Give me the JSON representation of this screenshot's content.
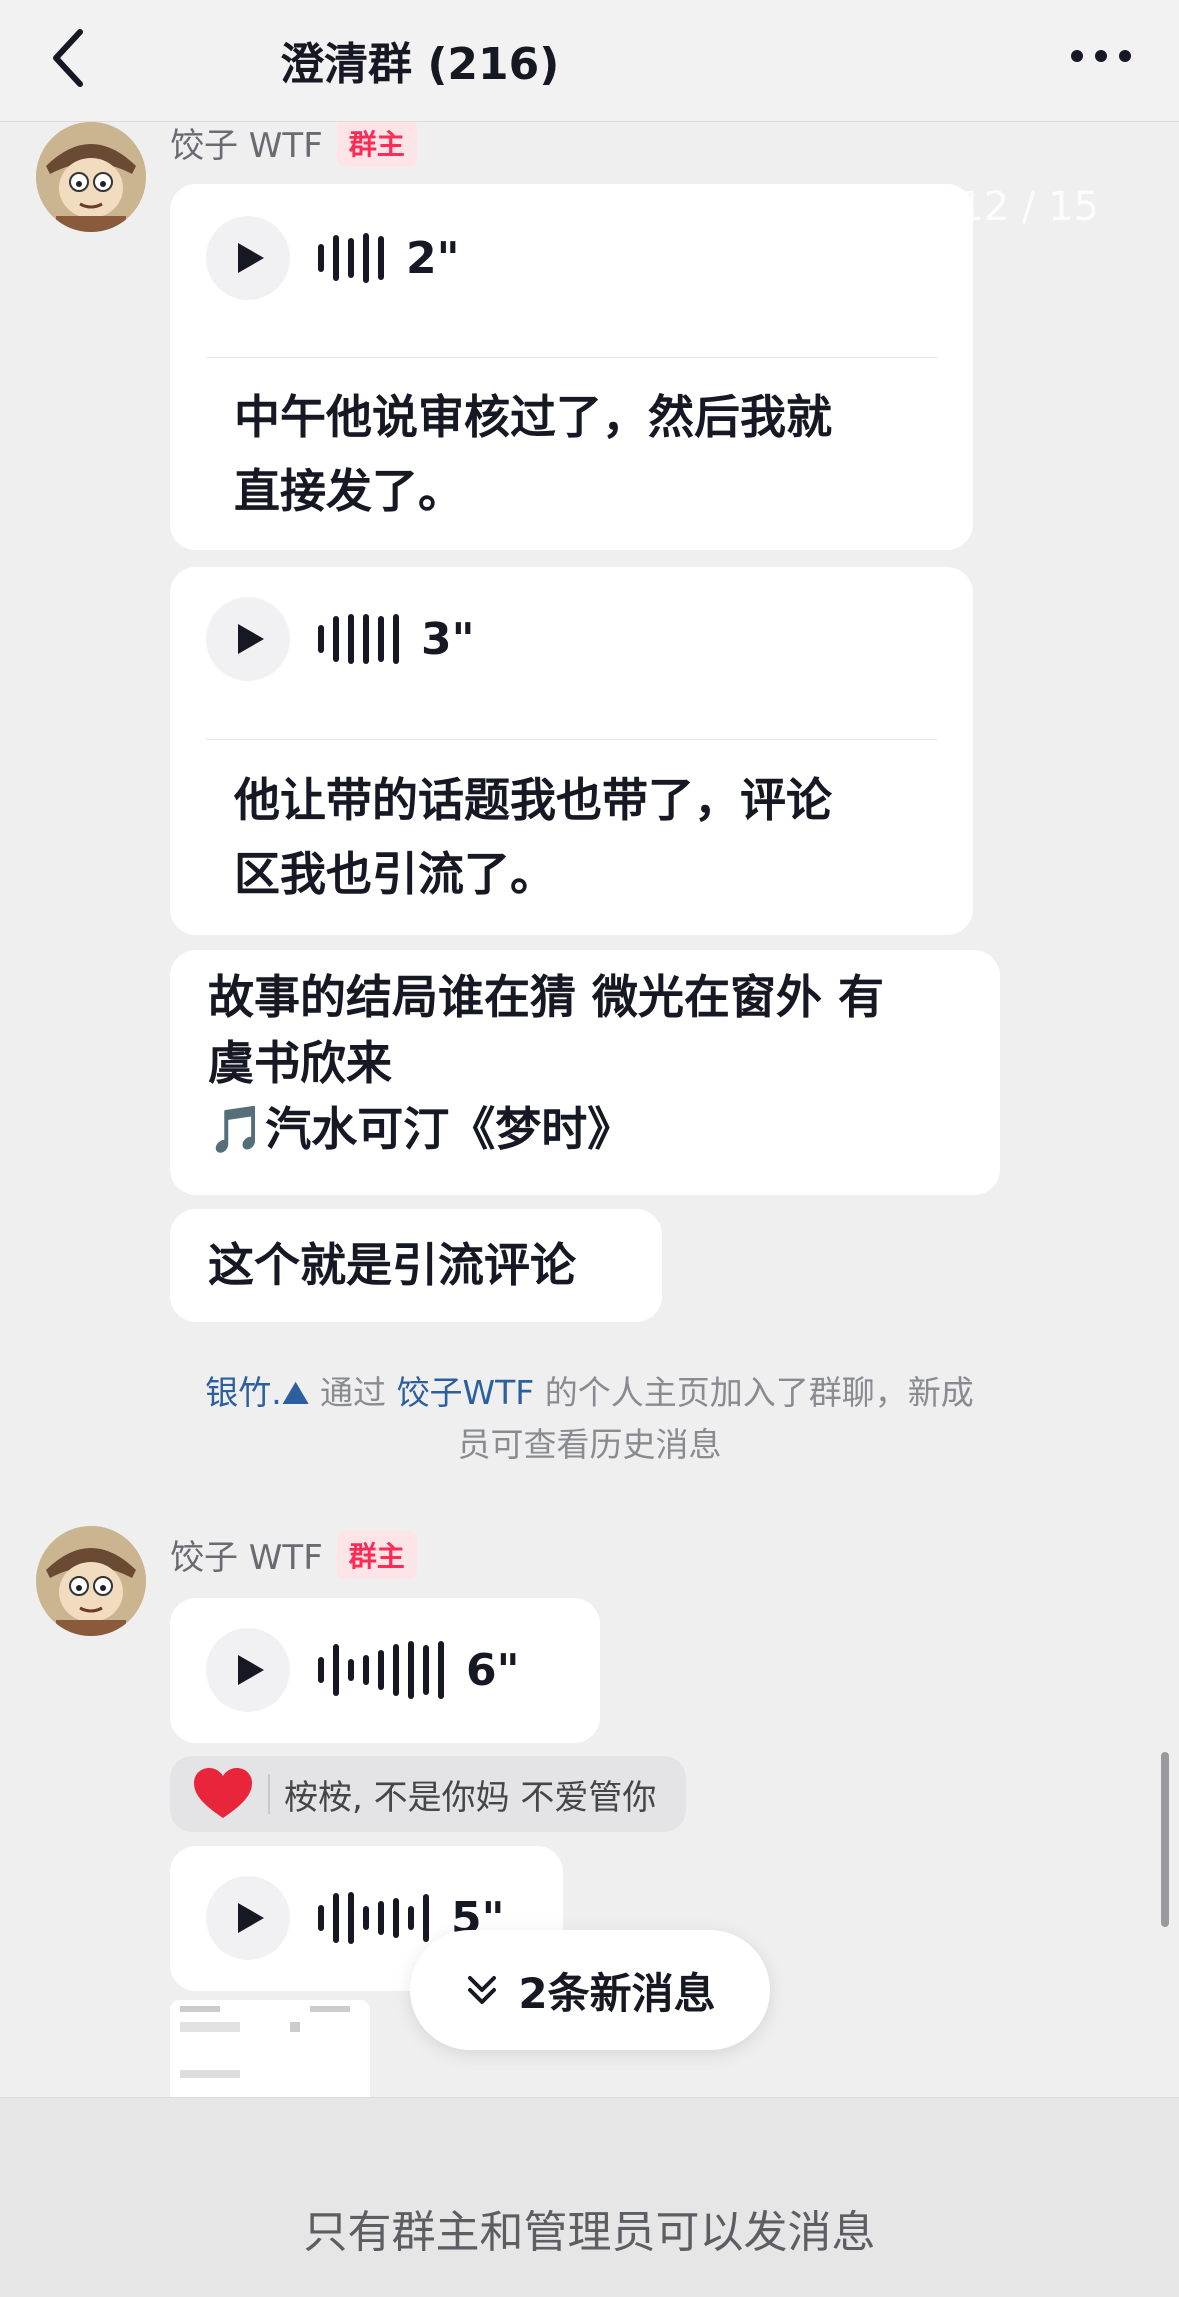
{
  "header": {
    "title": "澄清群 (216)"
  },
  "overlay": {
    "page_counter": "12 / 15"
  },
  "messages": [
    {
      "sender": "饺子 WTF",
      "badge": "群主",
      "voice": {
        "duration": "2\"",
        "transcript_line1": "中午他说审核过了，然后我就",
        "transcript_line2": "直接发了。"
      }
    },
    {
      "voice": {
        "duration": "3\"",
        "transcript_line1": "他让带的话题我也带了，评论",
        "transcript_line2": "区我也引流了。"
      }
    },
    {
      "text_line1": "故事的结局谁在猜 微光在窗外 有",
      "text_line2": "虞书欣来",
      "text_line3": "🎵汽水可汀《梦时》"
    },
    {
      "text": "这个就是引流评论"
    }
  ],
  "system_message": {
    "user": "银竹.⛰",
    "middle": " 通过 ",
    "inviter": "饺子WTF",
    "rest_line1": " 的个人主页加入了群聊，新成",
    "rest_line2": "员可查看历史消息"
  },
  "messages2": [
    {
      "sender": "饺子 WTF",
      "badge": "群主",
      "voice": {
        "duration": "6\""
      }
    },
    {
      "reaction_text": "桉桉, 不是你妈 不爱管你"
    },
    {
      "voice": {
        "duration": "5\""
      }
    }
  ],
  "new_messages_pill": "2条新消息",
  "footer_notice": "只有群主和管理员可以发消息",
  "colors": {
    "badge": "#fe2c55",
    "link": "#2b5f9e",
    "heart": "#e8253a"
  }
}
